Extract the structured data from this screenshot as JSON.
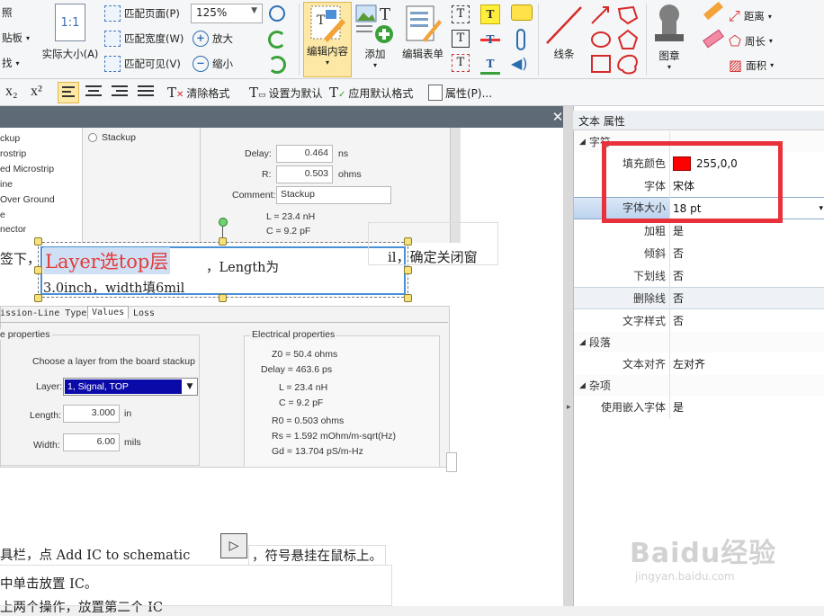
{
  "ribbon": {
    "clip_labels": [
      "照",
      "贴板",
      "找"
    ],
    "actual_size": {
      "icon_text": "1:1",
      "label": "实际大小(A)"
    },
    "fit_page": "匹配页面(P)",
    "fit_width": "匹配宽度(W)",
    "fit_visible": "匹配可见(V)",
    "zoom_value": "125%",
    "zoom_in": "放大",
    "zoom_out": "缩小",
    "edit_content": "编辑内容",
    "add": "添加",
    "edit_form": "编辑表单",
    "line": "线条",
    "stamp": "图章",
    "distance": "距离",
    "perimeter": "周长",
    "area": "面积"
  },
  "format_bar": {
    "subscript": "x₂",
    "superscript": "x²",
    "clear_format": "清除格式",
    "set_default": "设置为默认",
    "apply_default": "应用默认格式",
    "properties": "属性(P)..."
  },
  "document": {
    "left_list": [
      "ckup",
      "rostrip",
      "ed Microstrip",
      "ine",
      "Over Ground",
      "e",
      "nector"
    ],
    "stackup_radio": "Stackup",
    "delay_label": "Delay:",
    "delay_value": "0.464",
    "delay_unit": "ns",
    "r_label": "R:",
    "r_value": "0.503",
    "r_unit": "ohms",
    "comment_label": "Comment:",
    "comment_value": "Stackup",
    "l_value": "L = 23.4 nH",
    "c_value": "C = 9.2 pF",
    "text_prefix": "签下，",
    "highlight_text": "Layer选top层",
    "text_rest_1": "，Length为",
    "text_line_2": "3.0inch，width填6mil",
    "right_frag": "il，确定关闭窗",
    "tabs": [
      "ission-Line Type",
      "Values",
      "Loss"
    ],
    "props_legend": "e properties",
    "choose_layer": "Choose a layer from the board stackup",
    "layer_label": "Layer:",
    "layer_value": "1, Signal, TOP",
    "length_label": "Length:",
    "length_value": "3.000",
    "length_unit": "in",
    "width_label": "Width:",
    "width_value": "6.00",
    "width_unit": "mils",
    "elec_legend": "Electrical properties",
    "elec": [
      "Z0 =  50.4 ohms",
      "Delay = 463.6 ps",
      "L =  23.4 nH",
      "C =  9.2 pF",
      "R0 = 0.503 ohms",
      "Rs = 1.592 mOhm/m-sqrt(Hz)",
      "Gd = 13.704 pS/m-Hz"
    ],
    "bottom_1a": "具栏，点 Add IC to schematic",
    "bottom_1b": "，符号悬挂在鼠标上。",
    "bottom_2": "中单击放置 IC。",
    "bottom_3": "上两个操作，放置第二个 IC"
  },
  "panel": {
    "title": "文本 属性",
    "cat_font": "字符",
    "fill_color_label": "填充颜色",
    "fill_color_value": "255,0,0",
    "fill_color_hex": "#ff0000",
    "font_label": "字体",
    "font_value": "宋体",
    "size_label": "字体大小",
    "size_value": "18 pt",
    "bold_label": "加粗",
    "bold_value": "是",
    "italic_label": "倾斜",
    "italic_value": "否",
    "underline_label": "下划线",
    "underline_value": "否",
    "strike_label": "删除线",
    "strike_value": "否",
    "style_label": "文字样式",
    "style_value": "否",
    "cat_para": "段落",
    "align_label": "文本对齐",
    "align_value": "左对齐",
    "cat_misc": "杂项",
    "embed_label": "使用嵌入字体",
    "embed_value": "是"
  },
  "watermark": {
    "logo": "Baidu经验",
    "url": "jingyan.baidu.com"
  }
}
